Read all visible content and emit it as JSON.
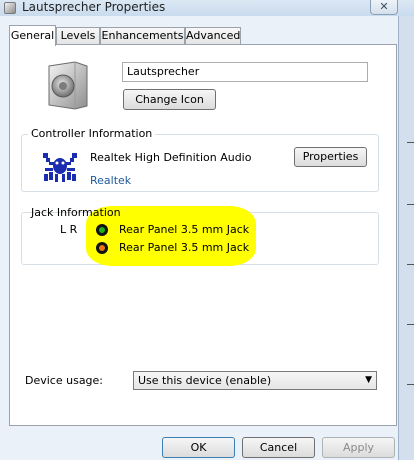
{
  "window": {
    "title": "Lautsprecher Properties",
    "close_glyph": "✕"
  },
  "tabs": [
    {
      "label": "General",
      "active": true
    },
    {
      "label": "Levels",
      "active": false
    },
    {
      "label": "Enhancements",
      "active": false
    },
    {
      "label": "Advanced",
      "active": false
    }
  ],
  "general": {
    "device_name": "Lautsprecher",
    "change_icon_label": "Change Icon"
  },
  "controller": {
    "group_label": "Controller Information",
    "name": "Realtek High Definition Audio",
    "vendor": "Realtek",
    "properties_label": "Properties"
  },
  "jack": {
    "group_label": "Jack Information",
    "lr_label": "L R",
    "jacks": [
      {
        "label": "Rear Panel 3.5 mm Jack",
        "color": "#1db11d"
      },
      {
        "label": "Rear Panel 3.5 mm Jack",
        "color": "#e8741a"
      }
    ]
  },
  "usage": {
    "label": "Device usage:",
    "selected": "Use this device (enable)"
  },
  "footer": {
    "ok_label": "OK",
    "cancel_label": "Cancel",
    "apply_label": "Apply"
  },
  "colors": {
    "highlight": "#ffff00",
    "link": "#1e5a9c"
  }
}
